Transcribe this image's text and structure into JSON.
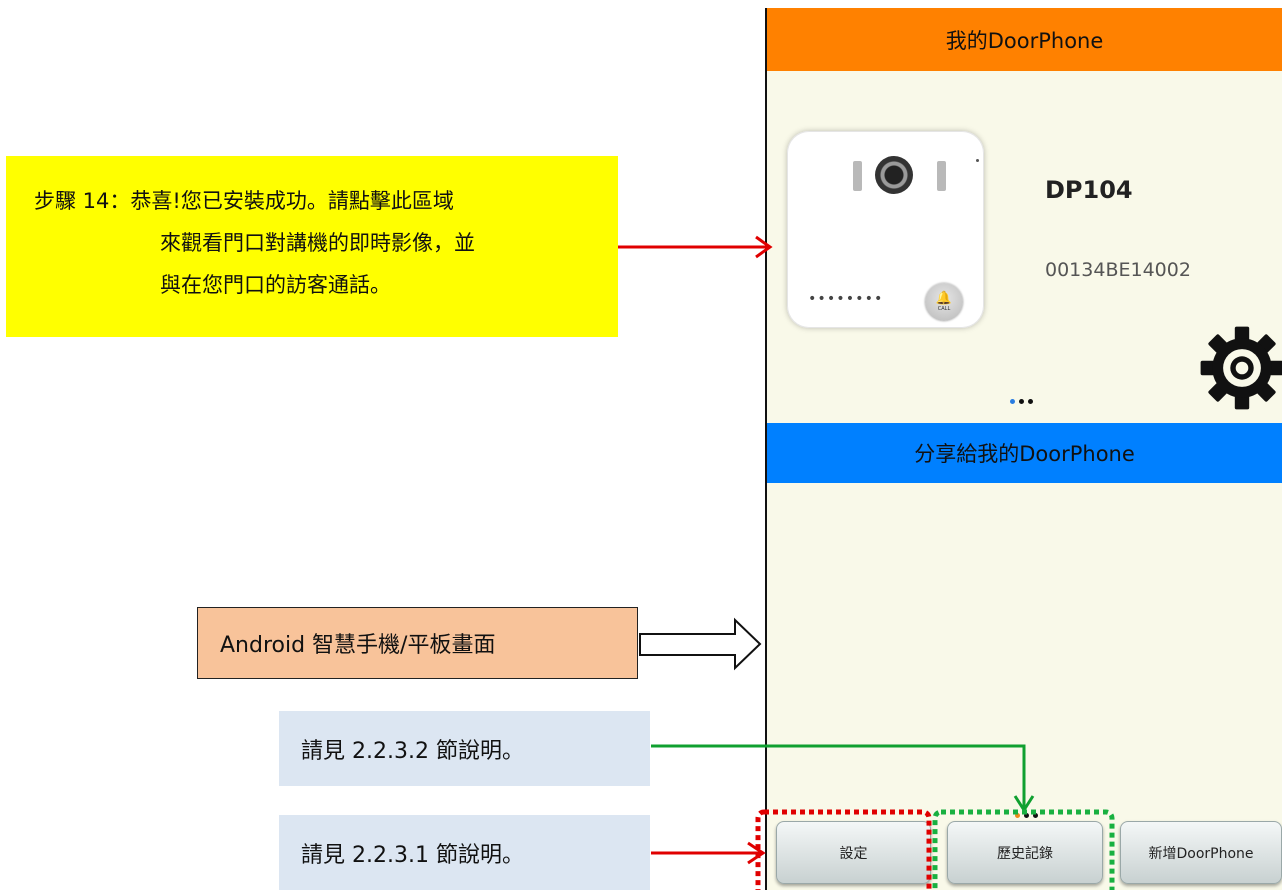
{
  "phone": {
    "header_title": "我的DoorPhone",
    "device": {
      "name": "DP104",
      "id": "00134BE14002",
      "speaker_dots": "••••••••",
      "call_label": "CALL"
    },
    "shared_header": "分享給我的DoorPhone",
    "buttons": {
      "settings": "設定",
      "history": "歷史記錄",
      "add": "新增DoorPhone"
    },
    "colors": {
      "header": "#ff8100",
      "shared_header": "#0080ff",
      "background": "#f9f9e9"
    }
  },
  "annotations": {
    "step_label": "步驟 14：",
    "step_line1": "恭喜!您已安裝成功。請點擊此區域",
    "step_line2": "來觀看門口對講機的即時影像，並",
    "step_line3": "與在您門口的訪客通話。",
    "platform_label": "Android 智慧手機/平板畫面",
    "ref_history": "請見 2.2.3.2 節說明。",
    "ref_settings": "請見 2.2.3.1 節說明。"
  }
}
